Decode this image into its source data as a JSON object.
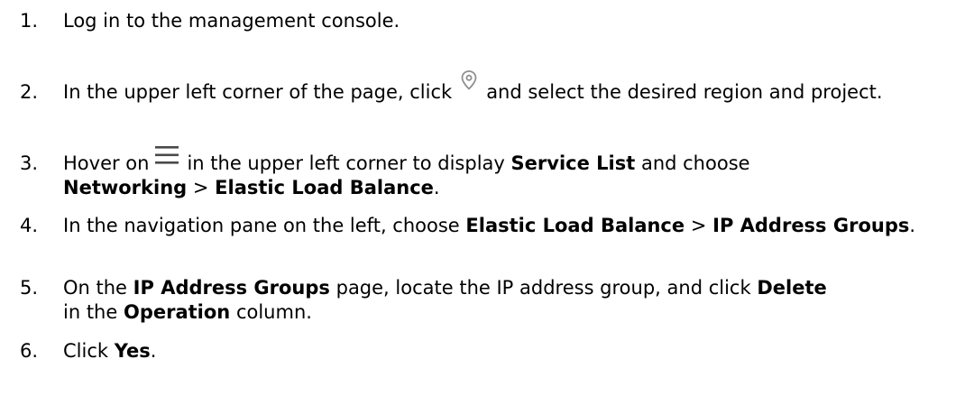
{
  "steps": [
    {
      "number": "1.",
      "parts": [
        "Log in to the management console."
      ]
    },
    {
      "number": "2.",
      "before": "In the upper left corner of the page, click",
      "icon": "location-pin-icon",
      "after": "and select the desired region and project."
    },
    {
      "number": "3.",
      "before": "Hover on",
      "icon": "menu-icon",
      "mid1": "in the upper left corner to display",
      "b1": "Service List",
      "mid2": "and choose",
      "b2": "Networking",
      "sep": ">",
      "b3": "Elastic Load Balance",
      "end": "."
    },
    {
      "number": "4.",
      "before": "In the navigation pane on the left, choose",
      "b1": "Elastic Load Balance",
      "sep": ">",
      "b2": "IP Address Groups",
      "end": "."
    },
    {
      "number": "5.",
      "t1": "On the",
      "b1": "IP Address Groups",
      "t2": "page, locate the IP address group, and click",
      "b2": "Delete",
      "t3": "in the",
      "b3": "Operation",
      "t4": "column."
    },
    {
      "number": "6.",
      "t1": "Click",
      "b1": "Yes",
      "end": "."
    }
  ],
  "colors": {
    "text": "#000000",
    "icon": "#4a4a4a",
    "pin_icon": "#8f8f8f"
  }
}
